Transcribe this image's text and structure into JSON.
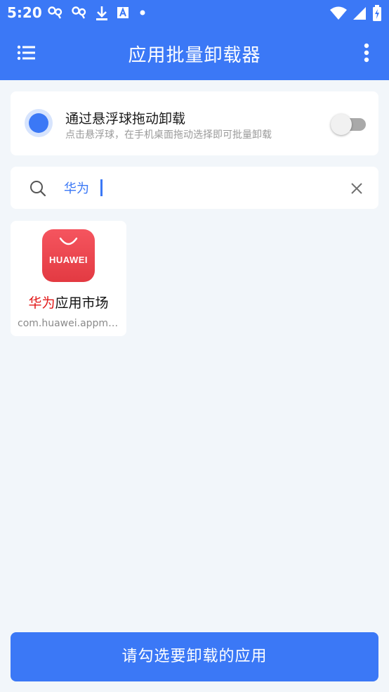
{
  "status_bar": {
    "time": "5:20",
    "left_icons": [
      "ribbon-icon",
      "ribbon-icon",
      "download-icon",
      "font-icon",
      "dot-icon"
    ],
    "right_icons": [
      "wifi-icon",
      "cellular-icon",
      "battery-charging-icon"
    ]
  },
  "app_bar": {
    "title": "应用批量卸载器",
    "menu_icon": "list-menu-icon",
    "more_icon": "more-vert-icon"
  },
  "float_option": {
    "title": "通过悬浮球拖动卸载",
    "subtitle": "点击悬浮球，在手机桌面拖动选择即可批量卸载",
    "toggle_on": false
  },
  "search": {
    "value": "华为",
    "placeholder": ""
  },
  "apps": [
    {
      "icon_brand": "HUAWEI",
      "name_highlight": "华为",
      "name_rest": "应用市场",
      "package": "com.huawei.appmarket"
    }
  ],
  "bottom_button": {
    "label": "请勾选要卸载的应用"
  },
  "colors": {
    "primary": "#3b78f6",
    "highlight": "#e21818",
    "background": "#f2f6fa"
  }
}
